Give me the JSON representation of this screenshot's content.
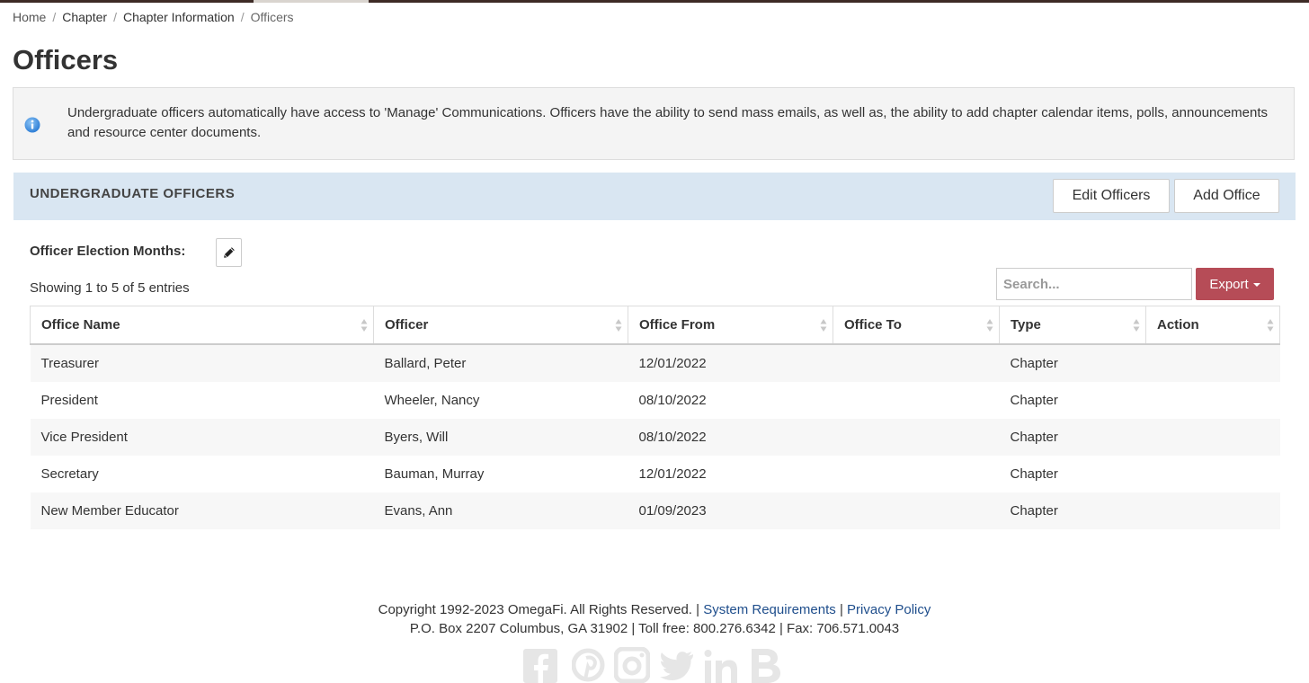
{
  "breadcrumb": {
    "items": [
      "Home",
      "Chapter",
      "Chapter Information"
    ],
    "separator": "/",
    "current": "Officers"
  },
  "page": {
    "title": "Officers"
  },
  "info": {
    "icon": "info-icon",
    "text": "Undergraduate officers automatically have access to 'Manage' Communications. Officers have the ability to send mass emails, as well as, the ability to add chapter calendar items, polls, announcements and resource center documents."
  },
  "panel": {
    "title": "UNDERGRADUATE OFFICERS",
    "edit_label": "Edit Officers",
    "add_label": "Add Office"
  },
  "election": {
    "label": "Officer Election Months:",
    "icon": "pencil-icon"
  },
  "table_info": {
    "showing": "Showing 1 to 5 of 5 entries"
  },
  "search": {
    "placeholder": "Search...",
    "value": ""
  },
  "export": {
    "label": "Export"
  },
  "table": {
    "columns": [
      "Office Name",
      "Officer",
      "Office From",
      "Office To",
      "Type",
      "Action"
    ],
    "rows": [
      [
        "Treasurer",
        "Ballard, Peter",
        "12/01/2022",
        "",
        "Chapter",
        ""
      ],
      [
        "President",
        "Wheeler, Nancy",
        "08/10/2022",
        "",
        "Chapter",
        ""
      ],
      [
        "Vice President",
        "Byers, Will",
        "08/10/2022",
        "",
        "Chapter",
        ""
      ],
      [
        "Secretary",
        "Bauman, Murray",
        "12/01/2022",
        "",
        "Chapter",
        ""
      ],
      [
        "New Member Educator",
        "Evans, Ann",
        "01/09/2023",
        "",
        "Chapter",
        ""
      ]
    ]
  },
  "footer": {
    "copyright": "Copyright 1992-2023 OmegaFi. All Rights Reserved.",
    "divider": "|",
    "sysreq": "System Requirements",
    "privacy": "Privacy Policy",
    "address": "P.O. Box 2207 Columbus, GA 31902 | Toll free: 800.276.6342 | Fax: 706.571.0043",
    "social_icons": [
      "facebook-icon",
      "pinterest-icon",
      "instagram-icon",
      "twitter-icon",
      "linkedin-icon",
      "blog-icon"
    ]
  },
  "colors": {
    "topbar": "#3d2b26",
    "panel_header": "#d9e6f2",
    "export_button": "#b64c57",
    "link": "#1f4e8c",
    "info_icon": "#3a8ee0"
  }
}
